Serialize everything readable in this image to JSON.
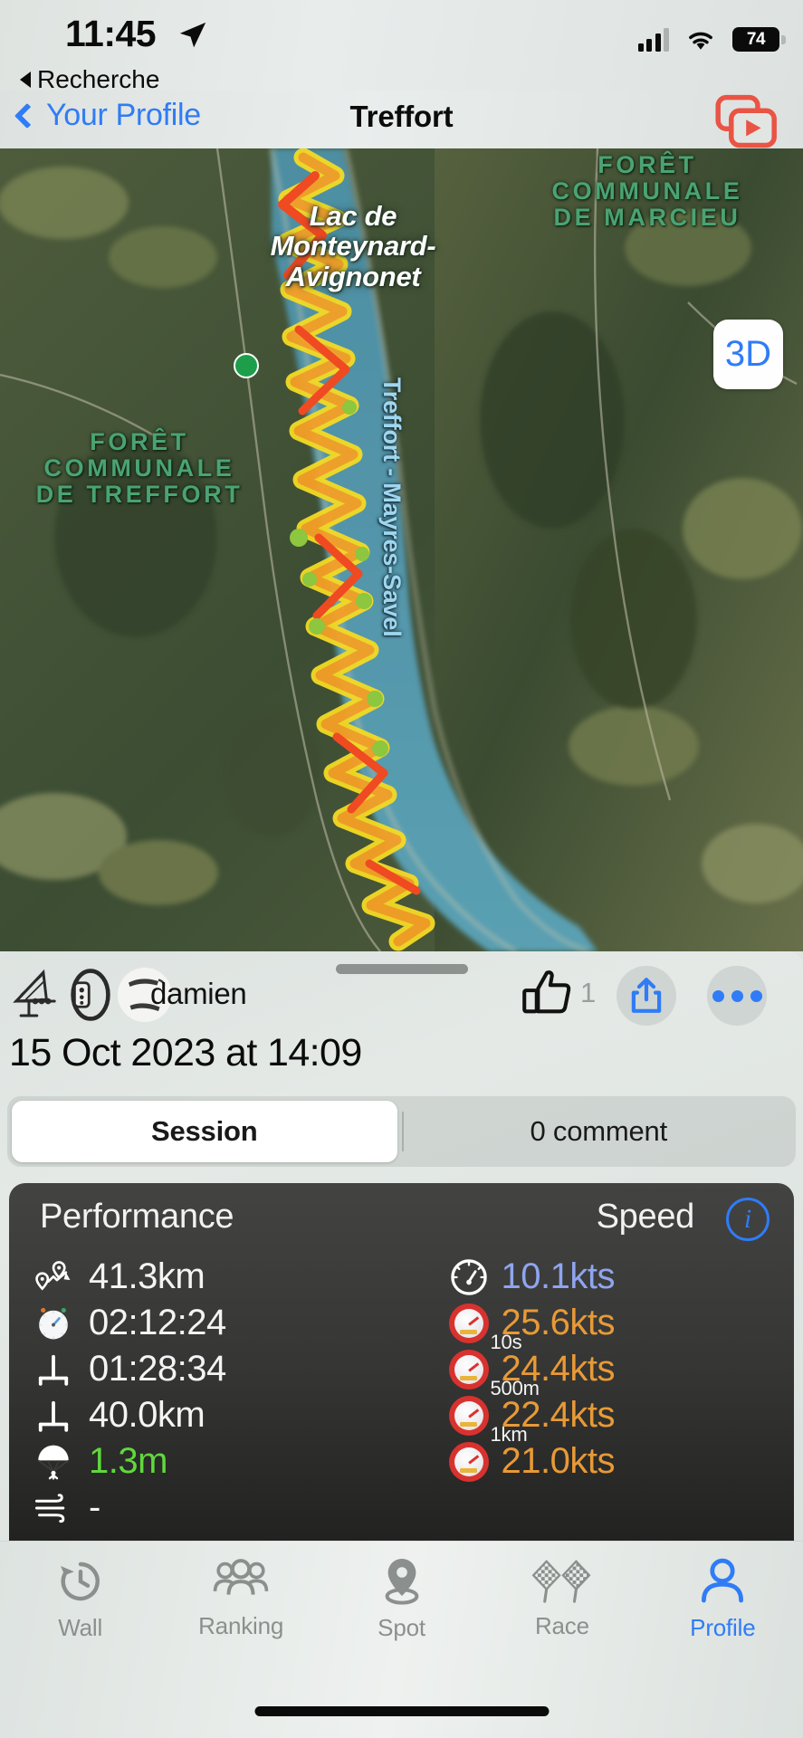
{
  "status_bar": {
    "time": "11:45",
    "back_app": "Recherche",
    "battery": "74",
    "location_icon": "location-arrow-icon",
    "signal_icon": "cellular-signal-icon",
    "wifi_icon": "wifi-icon"
  },
  "nav": {
    "back_label": "Your Profile",
    "title": "Treffort",
    "replay_icon": "video-replay-icon"
  },
  "map": {
    "lake_label": "Lac de\nMonteynard-\nAvignonet",
    "lake_label_l1": "Lac de",
    "lake_label_l2": "Monteynard-",
    "lake_label_l3": "Avignonet",
    "forest_right_l1": "FORÊT",
    "forest_right_l2": "COMMUNALE",
    "forest_right_l3": "DE MARCIEU",
    "forest_left_l1": "FORÊT",
    "forest_left_l2": "COMMUNALE",
    "forest_left_l3": "DE TREFFORT",
    "route_label": "Treffort - Mayres-Savel",
    "view_toggle": "3D",
    "track_colors": [
      "#f5e02a",
      "#f9a227",
      "#ef4e23",
      "#8ec63f"
    ],
    "water_color": "#4f93a8"
  },
  "sheet": {
    "grabber": "drag-handle",
    "user_name": "damien",
    "sport_icon": "windsurf-sail-icon",
    "device_icon": "gps-tracker-icon",
    "avatar": "user-avatar",
    "like_count": "1",
    "like_icon": "thumbs-up-icon",
    "share_icon": "share-icon",
    "more_icon": "more-dots-icon",
    "session_date": "15 Oct 2023 at 14:09",
    "tabs": [
      {
        "label": "Session",
        "active": true
      },
      {
        "label": "0 comment",
        "active": false
      }
    ]
  },
  "stats": {
    "header_left": "Performance",
    "header_right": "Speed",
    "info_icon": "info-icon",
    "accent_green": "#5fd93c",
    "accent_blue": "#8fa5f0",
    "accent_orange": "#e89a36",
    "performance": [
      {
        "icon": "route-distance-icon",
        "value": "41.3km",
        "color": "white"
      },
      {
        "icon": "stopwatch-icon",
        "value": "02:12:24",
        "color": "white"
      },
      {
        "icon": "planing-time-icon",
        "value": "01:28:34",
        "color": "white"
      },
      {
        "icon": "planing-distance-icon",
        "value": "40.0km",
        "color": "white"
      },
      {
        "icon": "jump-parachute-icon",
        "value": "1.3m",
        "color": "green"
      },
      {
        "icon": "wind-icon",
        "value": "-",
        "color": "white"
      }
    ],
    "speed": [
      {
        "icon": "average-speed-icon",
        "caption": "",
        "value": "10.1kts",
        "color": "blue"
      },
      {
        "icon": "max-speed-icon",
        "caption": "",
        "value": "25.6kts",
        "color": "orange"
      },
      {
        "icon": "max-speed-icon",
        "caption": "10s",
        "value": "24.4kts",
        "color": "orange"
      },
      {
        "icon": "max-speed-icon",
        "caption": "500m",
        "value": "22.4kts",
        "color": "orange"
      },
      {
        "icon": "max-speed-icon",
        "caption": "1km",
        "value": "21.0kts",
        "color": "orange"
      }
    ]
  },
  "tabbar": {
    "items": [
      {
        "label": "Wall",
        "icon": "history-clock-icon",
        "active": false
      },
      {
        "label": "Ranking",
        "icon": "people-group-icon",
        "active": false
      },
      {
        "label": "Spot",
        "icon": "map-pin-icon",
        "active": false
      },
      {
        "label": "Race",
        "icon": "checkered-flags-icon",
        "active": false
      },
      {
        "label": "Profile",
        "icon": "person-icon",
        "active": true
      }
    ],
    "active_color": "#2f7cf6",
    "inactive_color": "#8b908e"
  }
}
